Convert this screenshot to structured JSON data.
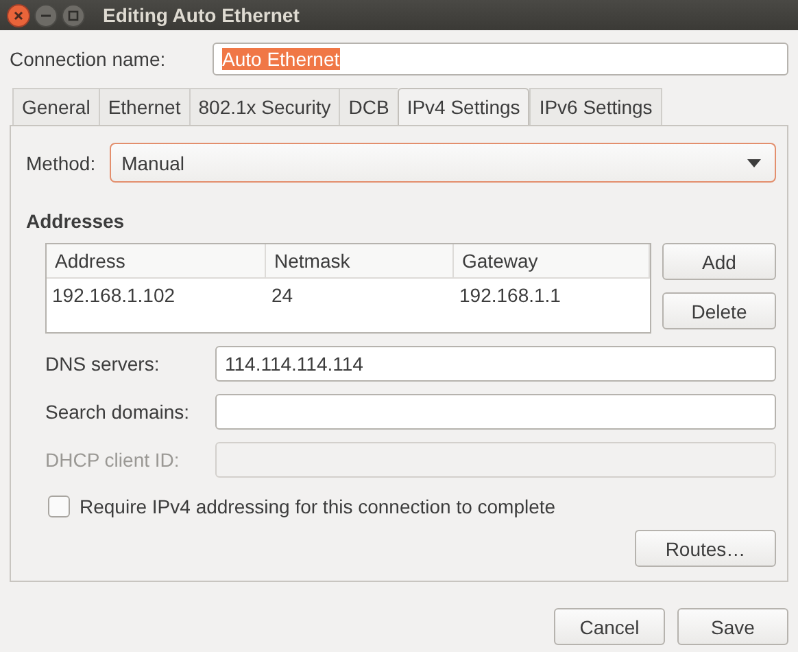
{
  "window": {
    "title": "Editing Auto Ethernet"
  },
  "connection_name": {
    "label": "Connection name:",
    "value": "Auto Ethernet",
    "text_selected": true
  },
  "tabs": [
    {
      "label": "General",
      "selected": false
    },
    {
      "label": "Ethernet",
      "selected": false
    },
    {
      "label": "802.1x Security",
      "selected": false
    },
    {
      "label": "DCB",
      "selected": false
    },
    {
      "label": "IPv4 Settings",
      "selected": true
    },
    {
      "label": "IPv6 Settings",
      "selected": false
    }
  ],
  "method": {
    "label": "Method:",
    "value": "Manual",
    "focused": true
  },
  "addresses": {
    "heading": "Addresses",
    "columns": [
      "Address",
      "Netmask",
      "Gateway"
    ],
    "rows": [
      [
        "192.168.1.102",
        "24",
        "192.168.1.1"
      ]
    ],
    "buttons": [
      "Add",
      "Delete"
    ]
  },
  "fields": [
    {
      "label": "DNS servers:",
      "value": "114.114.114.114",
      "disabled": false
    },
    {
      "label": "Search domains:",
      "disabled": false
    },
    {
      "label": "DHCP client ID:",
      "disabled": true
    }
  ],
  "require_checkbox": {
    "label": "Require IPv4 addressing for this connection to complete",
    "checked": false
  },
  "routes_button": "Routes…",
  "buttons": [
    "Cancel",
    "Save"
  ]
}
